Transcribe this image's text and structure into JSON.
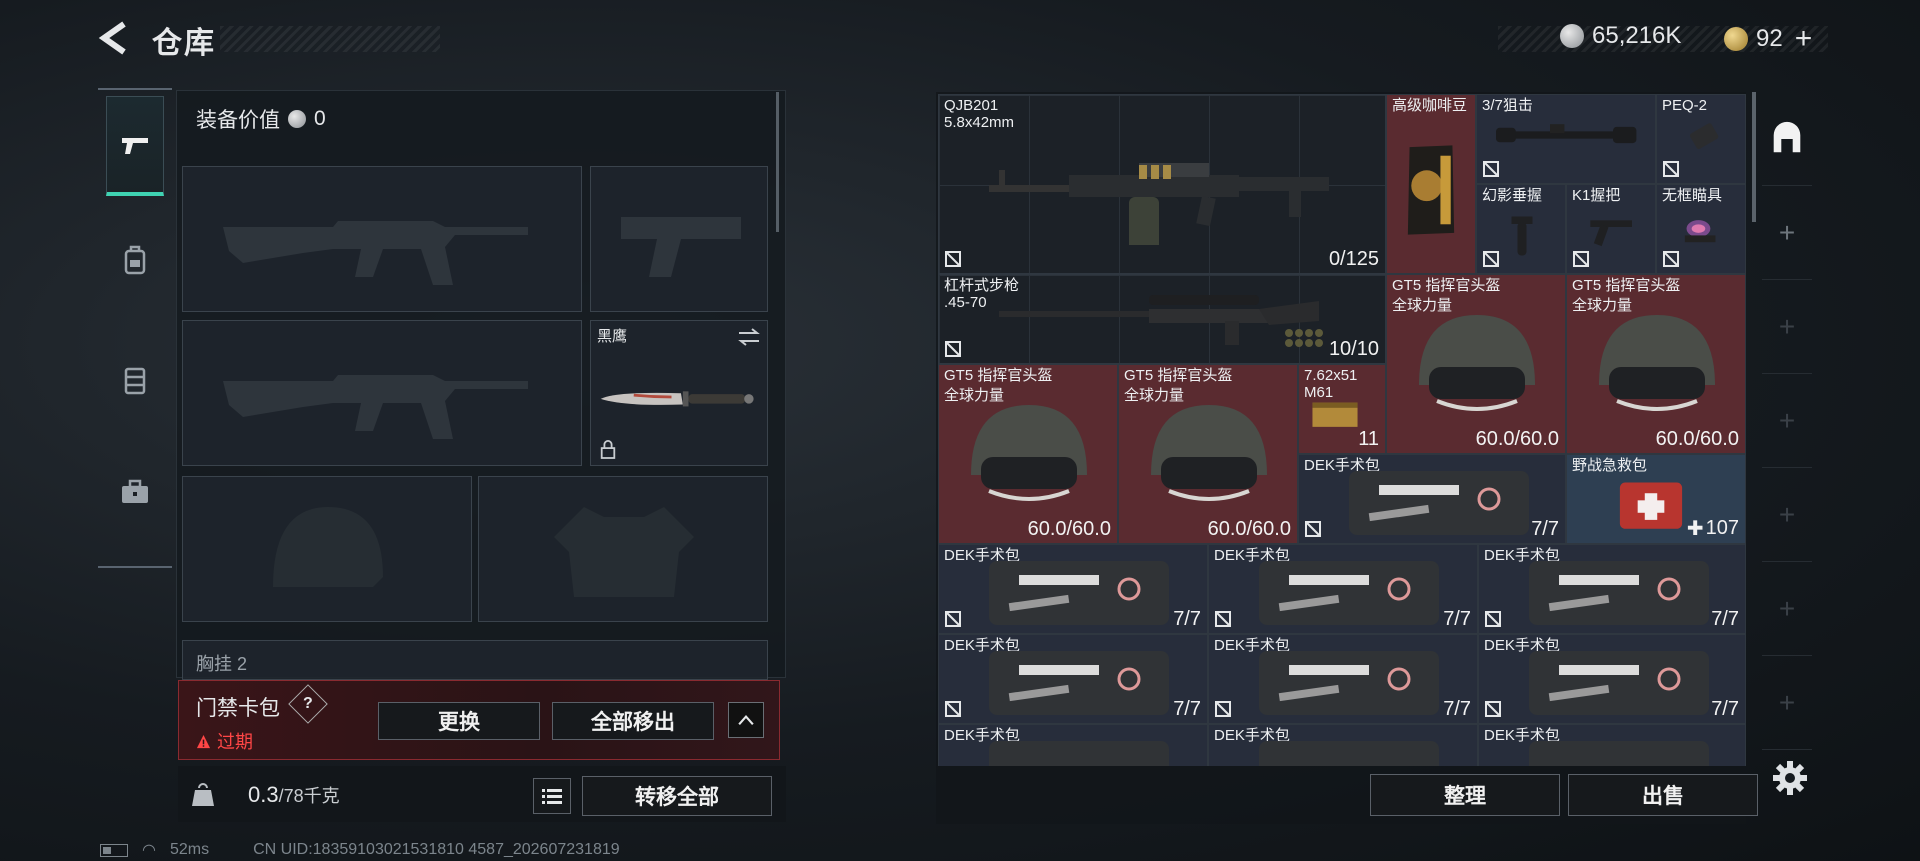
{
  "header": {
    "title": "仓库",
    "currency_silver": "65,216K",
    "currency_gold": "92",
    "add_label": "+"
  },
  "left": {
    "categories": [
      "weapons",
      "backpack",
      "vest",
      "briefcase"
    ],
    "equip_value_label": "装备价值",
    "equip_value": "0",
    "knife_slot_label": "黑鹰",
    "chest_label": "胸挂",
    "chest_count": "2",
    "access_card": {
      "title": "门禁卡包",
      "help": "?",
      "status": "过期",
      "replace_label": "更换",
      "remove_all_label": "全部移出"
    },
    "weight": {
      "current": "0.3",
      "max": "/78千克",
      "kg_badge": "KG"
    },
    "transfer_all_label": "转移全部"
  },
  "status": {
    "ping": "52ms",
    "uid": "CN UID:18359103021531810 4587_202607231819"
  },
  "stash": {
    "items": [
      {
        "name": "QJB201",
        "sub": "5.8x42mm",
        "count": "0/125"
      },
      {
        "name": "高级咖啡豆",
        "sub": "",
        "count": ""
      },
      {
        "name": "3/7狙击",
        "sub": "",
        "count": ""
      },
      {
        "name": "PEQ-2",
        "sub": "",
        "count": ""
      },
      {
        "name": "幻影垂握",
        "sub": "",
        "count": ""
      },
      {
        "name": "K1握把",
        "sub": "",
        "count": ""
      },
      {
        "name": "无框瞄具",
        "sub": "",
        "count": ""
      },
      {
        "name": "杠杆式步枪",
        "sub": ".45-70",
        "count": "10/10"
      },
      {
        "name": "GT5 指挥官头盔",
        "sub": "全球力量",
        "count": "60.0/60.0"
      },
      {
        "name": "GT5 指挥官头盔",
        "sub": "全球力量",
        "count": "60.0/60.0"
      },
      {
        "name": "GT5 指挥官头盔",
        "sub": "全球力量",
        "count": "60.0/60.0"
      },
      {
        "name": "GT5 指挥官头盔",
        "sub": "全球力量",
        "count": "60.0/60.0"
      },
      {
        "name": "7.62x51",
        "sub": "M61",
        "count": "11"
      },
      {
        "name": "DEK手术包",
        "sub": "",
        "count": "7/7"
      },
      {
        "name": "野战急救包",
        "sub": "",
        "count": "107"
      },
      {
        "name": "DEK手术包",
        "sub": "",
        "count": "7/7"
      },
      {
        "name": "DEK手术包",
        "sub": "",
        "count": "7/7"
      },
      {
        "name": "DEK手术包",
        "sub": "",
        "count": "7/7"
      },
      {
        "name": "DEK手术包",
        "sub": "",
        "count": "7/7"
      },
      {
        "name": "DEK手术包",
        "sub": "",
        "count": "7/7"
      },
      {
        "name": "DEK手术包",
        "sub": "",
        "count": "7/7"
      },
      {
        "name": "DEK手术包",
        "sub": "",
        "count": ""
      },
      {
        "name": "DEK手术包",
        "sub": "",
        "count": ""
      },
      {
        "name": "DEK手术包",
        "sub": "",
        "count": ""
      }
    ],
    "sort_label": "整理",
    "sell_label": "出售",
    "side_tabs": [
      "+",
      "+",
      "+",
      "+",
      "+",
      "+",
      "+"
    ]
  },
  "colors": {
    "accent": "#3fd3b2",
    "expired": "#ff4646",
    "red_cell": "#5a2b30",
    "blue_cell": "#2e3f52",
    "card_border": "#8a2a30"
  }
}
